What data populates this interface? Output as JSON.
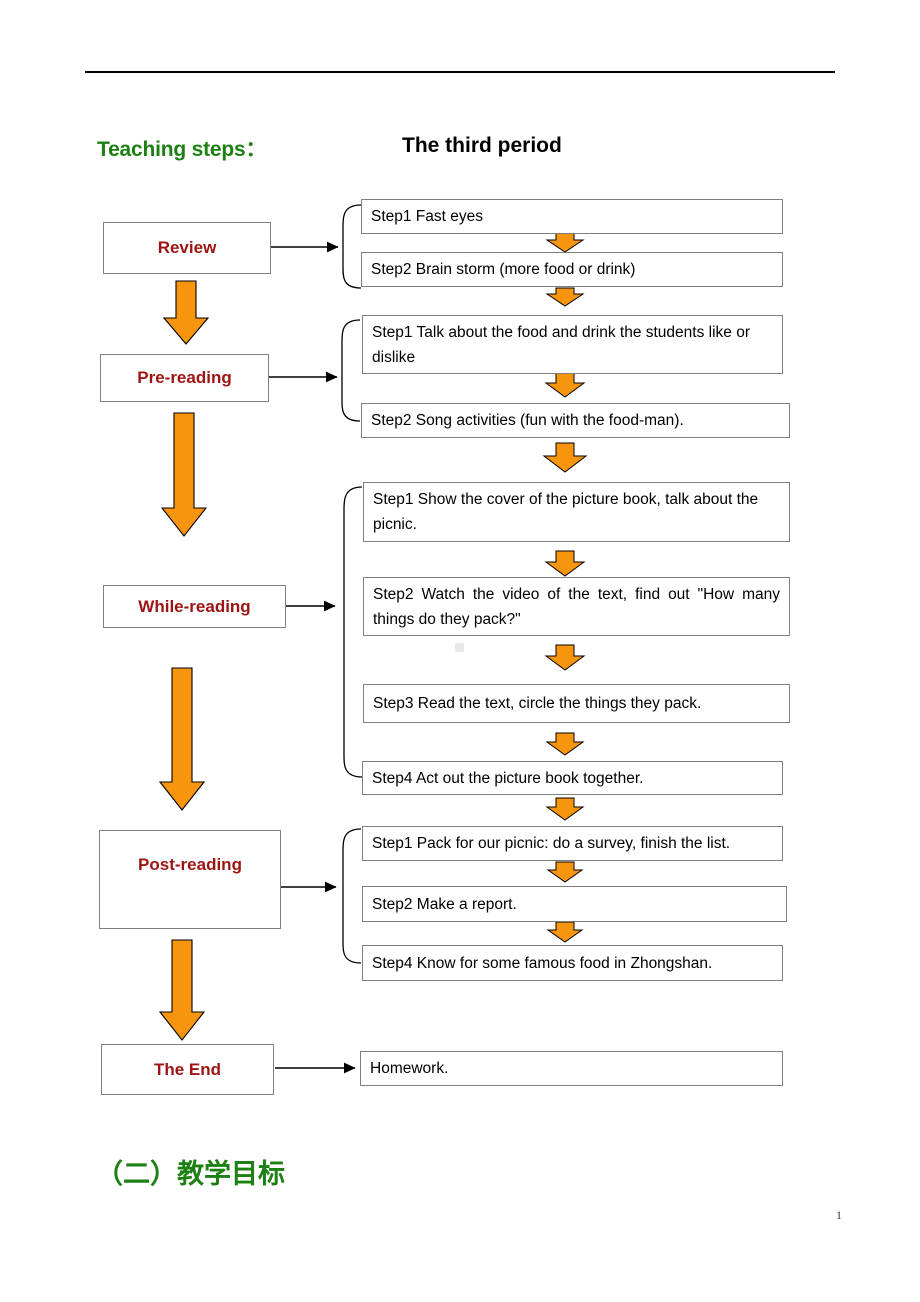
{
  "document": {
    "page_number": "1",
    "headings": {
      "teaching_steps": "Teaching steps：",
      "period_title": "The third period",
      "section_cn": "（二）教学目标"
    },
    "colors": {
      "heading_green": "#1d8013",
      "stage_label_red": "#9e1414",
      "arrow_orange": "#f7960e",
      "box_border_gray": "#7f7f7f",
      "text_black": "#000000"
    }
  },
  "flow": {
    "stages": [
      {
        "id": "review",
        "label": "Review"
      },
      {
        "id": "pre-reading",
        "label": "Pre-reading"
      },
      {
        "id": "while-reading",
        "label": "While-reading"
      },
      {
        "id": "post-reading",
        "label": "Post-reading"
      },
      {
        "id": "the-end",
        "label": "The End"
      }
    ],
    "steps": {
      "review": [
        {
          "text": "Step1 Fast eyes"
        },
        {
          "text": "Step2 Brain storm (more food or drink)"
        }
      ],
      "pre_reading": [
        {
          "text": "Step1 Talk about the food and drink the students like or dislike"
        },
        {
          "text": "Step2 Song activities (fun with the food-man)."
        }
      ],
      "while_reading": [
        {
          "text": "Step1 Show the cover of the picture book, talk about the picnic."
        },
        {
          "text": "Step2  Watch the video of the text, find out \"How many things do they pack?\""
        },
        {
          "text": "Step3 Read the text, circle the things they pack."
        },
        {
          "text": "Step4 Act out the picture book together."
        }
      ],
      "post_reading": [
        {
          "text": "Step1 Pack for our picnic: do a survey, finish the list."
        },
        {
          "text": "Step2 Make a report."
        },
        {
          "text": "Step4 Know for some famous food in Zhongshan."
        }
      ],
      "the_end": [
        {
          "text": "Homework."
        }
      ]
    }
  }
}
